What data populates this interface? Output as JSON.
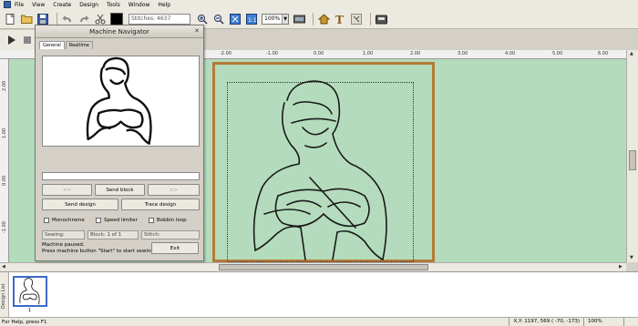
{
  "menu": [
    "File",
    "View",
    "Create",
    "Design",
    "Tools",
    "Window",
    "Help"
  ],
  "toolbar": {
    "stitches_label": "Stitches: 4637",
    "zoom_value": "100%",
    "icons": [
      "new-icon",
      "open-icon",
      "save-icon",
      "undo-icon",
      "redo-icon",
      "scissors-icon",
      "zoom-in-icon",
      "zoom-out-icon",
      "fit-icon",
      "actual-size-icon",
      "machine-icon",
      "hat-icon",
      "text-icon",
      "applique-icon",
      "sew-icon"
    ]
  },
  "ruler": {
    "top_labels": [
      "-2.00",
      "-1.00",
      "0.00",
      "1.00",
      "2.00",
      "3.00",
      "4.00",
      "5.00",
      "6.00"
    ],
    "left_labels": [
      "2.00",
      "1.00",
      "0.00",
      "-1.00"
    ]
  },
  "dialog": {
    "title": "Machine Navigator",
    "tabs": [
      "General",
      "Realtime"
    ],
    "prev_label": "<<",
    "send_block_label": "Send block",
    "next_label": ">>",
    "send_design_label": "Send design",
    "trace_design_label": "Trace design",
    "monochrome_label": "Monochrome",
    "speed_limiter_label": "Speed limiter",
    "bobbin_loop_label": "Bobbin loop",
    "sewing_label": "Sewing:",
    "block_label": "Block: 1 of 1",
    "stitch_label": "Stitch:",
    "message_line1": "Machine paused.",
    "message_line2": "Press machine button \"Start\" to start sewing.",
    "exit_label": "Exit"
  },
  "thumbnails": {
    "sidebar_label": "Design List",
    "items": [
      {
        "number": "1"
      }
    ]
  },
  "status": {
    "help": "For Help, press F1",
    "xy_label": "X,Y:",
    "xy": "1197, 569",
    "coords": "( -70, -173)",
    "zoom": "100%"
  },
  "colors": {
    "canvas_bg": "#b4dcbc",
    "hoop": "#b57a3a",
    "thumb_border": "#3b6bc7"
  }
}
